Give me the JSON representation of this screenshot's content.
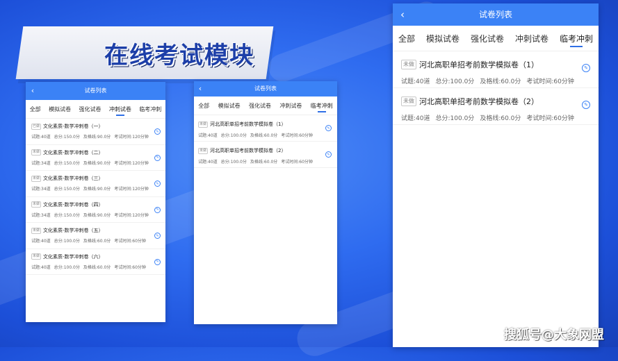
{
  "banner": {
    "title": "在线考试模块"
  },
  "phones": {
    "left": {
      "header_title": "试卷列表",
      "back_glyph": "‹",
      "tabs": [
        "全部",
        "模拟试卷",
        "强化试卷",
        "冲刺试卷",
        "临考冲刺"
      ],
      "active_tab": "冲刺试卷",
      "items": [
        {
          "badge": "已做",
          "title": "文化素质-数学冲刺卷（一）",
          "questions": "试题:40道",
          "total": "总分:150.0分",
          "pass": "及格线:90.0分",
          "time": "考试时间:120分钟"
        },
        {
          "badge": "未做",
          "title": "文化素质-数学冲刺卷（二）",
          "questions": "试题:34道",
          "total": "总分:150.0分",
          "pass": "及格线:90.0分",
          "time": "考试时间:120分钟"
        },
        {
          "badge": "未做",
          "title": "文化素质-数学冲刺卷（三）",
          "questions": "试题:34道",
          "total": "总分:150.0分",
          "pass": "及格线:90.0分",
          "time": "考试时间:120分钟"
        },
        {
          "badge": "未做",
          "title": "文化素质-数学冲刺卷（四）",
          "questions": "试题:34道",
          "total": "总分:150.0分",
          "pass": "及格线:90.0分",
          "time": "考试时间:120分钟"
        },
        {
          "badge": "未做",
          "title": "文化素质-数学冲刺卷（五）",
          "questions": "试题:40道",
          "total": "总分:100.0分",
          "pass": "及格线:60.0分",
          "time": "考试时间:60分钟"
        },
        {
          "badge": "未做",
          "title": "文化素质-数学冲刺卷（六）",
          "questions": "试题:40道",
          "total": "总分:100.0分",
          "pass": "及格线:60.0分",
          "time": "考试时间:60分钟"
        }
      ]
    },
    "middle": {
      "header_title": "试卷列表",
      "back_glyph": "‹",
      "tabs": [
        "全部",
        "模拟试卷",
        "强化试卷",
        "冲刺试卷",
        "临考冲刺"
      ],
      "active_tab": "临考冲刺",
      "items": [
        {
          "badge": "未做",
          "title": "河北高职单招考前数学模拟卷（1）",
          "questions": "试题:40道",
          "total": "总分:100.0分",
          "pass": "及格线:60.0分",
          "time": "考试时间:60分钟"
        },
        {
          "badge": "未做",
          "title": "河北高职单招考前数学模拟卷（2）",
          "questions": "试题:40道",
          "total": "总分:100.0分",
          "pass": "及格线:60.0分",
          "time": "考试时间:60分钟"
        }
      ]
    },
    "right": {
      "header_title": "试卷列表",
      "back_glyph": "‹",
      "tabs": [
        "全部",
        "模拟试卷",
        "强化试卷",
        "冲刺试卷",
        "临考冲刺"
      ],
      "active_tab": "临考冲刺",
      "items": [
        {
          "badge": "未做",
          "title": "河北高职单招考前数学模拟卷（1）",
          "questions": "试题:40道",
          "total": "总分:100.0分",
          "pass": "及格线:60.0分",
          "time": "考试时间:60分钟"
        },
        {
          "badge": "未做",
          "title": "河北高职单招考前数学模拟卷（2）",
          "questions": "试题:40道",
          "total": "总分:100.0分",
          "pass": "及格线:60.0分",
          "time": "考试时间:60分钟"
        }
      ]
    }
  },
  "edit_icon_glyph": "✎",
  "watermark": "搜狐号@大象网盟",
  "colors": {
    "accent": "#3b82f6",
    "background": "#2f6cf0"
  }
}
